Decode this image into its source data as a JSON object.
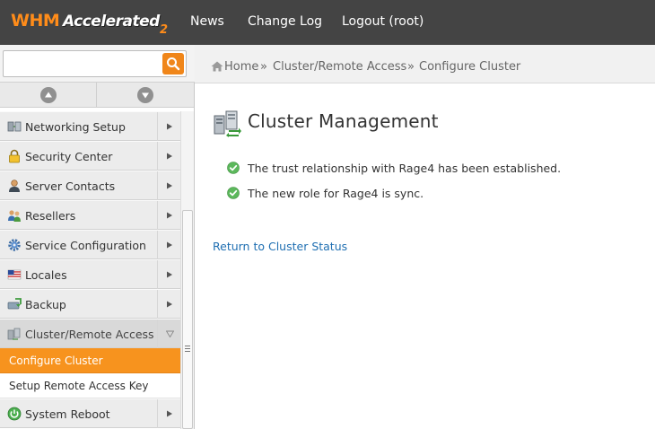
{
  "header": {
    "logo_whm": "WHM",
    "logo_accelerated": "Accelerated",
    "logo_suffix": "2",
    "nav": [
      "News",
      "Change Log",
      "Logout (root)"
    ]
  },
  "search": {
    "value": "",
    "placeholder": ""
  },
  "sidebar": {
    "items": [
      {
        "label": "Networking Setup",
        "icon": "network-icon"
      },
      {
        "label": "Security Center",
        "icon": "lock-icon"
      },
      {
        "label": "Server Contacts",
        "icon": "contact-icon"
      },
      {
        "label": "Resellers",
        "icon": "resellers-icon"
      },
      {
        "label": "Service Configuration",
        "icon": "gear-icon"
      },
      {
        "label": "Locales",
        "icon": "flag-icon"
      },
      {
        "label": "Backup",
        "icon": "backup-icon"
      },
      {
        "label": "Cluster/Remote Access",
        "icon": "cluster-icon",
        "expanded": true
      },
      {
        "label": "System Reboot",
        "icon": "power-icon"
      }
    ],
    "subitems": [
      {
        "label": "Configure Cluster",
        "active": true
      },
      {
        "label": "Setup Remote Access Key",
        "active": false
      }
    ]
  },
  "breadcrumb": {
    "home": "Home",
    "separator": "»",
    "items": [
      "Cluster/Remote Access",
      "Configure Cluster"
    ]
  },
  "main": {
    "title": "Cluster Management",
    "messages": [
      "The trust relationship with Rage4 has been established.",
      "The new role for Rage4 is sync."
    ],
    "return_link": "Return to Cluster Status"
  },
  "colors": {
    "topbar": "#444444",
    "accent": "#f7931e",
    "link": "#1f6fb2",
    "success": "#5cb85c"
  }
}
